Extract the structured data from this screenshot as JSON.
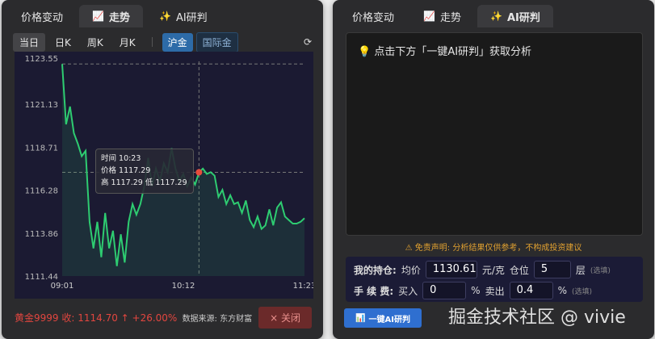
{
  "tabs": [
    "价格变动",
    "走势",
    "AI研判"
  ],
  "left": {
    "periods": [
      "当日",
      "日K",
      "周K",
      "月K"
    ],
    "markets": [
      "沪金",
      "国际金"
    ],
    "tooltip": {
      "time": "时间 10:23",
      "price": "价格 1117.29",
      "hl": "高 1117.29  低 1117.29"
    },
    "quote": "黄金9999  收: 1114.70 ↑ +26.00%",
    "source": "数据来源: 东方财富",
    "close": "× 关闭"
  },
  "chart_data": {
    "type": "line",
    "title": "",
    "yticks": [
      "1123.55",
      "1121.13",
      "1118.71",
      "1116.28",
      "1113.86",
      "1111.44"
    ],
    "ylim": [
      1111.44,
      1123.55
    ],
    "xticks": [
      "09:01",
      "10:12",
      "11:23"
    ],
    "series": [
      {
        "name": "黄金9999",
        "values": [
          1123.4,
          1120,
          1121,
          1119.5,
          1118.9,
          1118.2,
          1118.5,
          1114.5,
          1113,
          1114.5,
          1112.5,
          1115,
          1113,
          1114,
          1112,
          1113.8,
          1112.2,
          1114.5,
          1115.5,
          1114.9,
          1115.5,
          1116.5,
          1118.1,
          1116.5,
          1117.5,
          1116.8,
          1117.8,
          1117.3,
          1118.64,
          1117.5,
          1116.8,
          1117.2,
          1116.5,
          1117,
          1116.6,
          1117.29,
          1117.5,
          1117.2,
          1117.3,
          1117.1,
          1115.9,
          1116.3,
          1115.5,
          1116,
          1115.5,
          1115.6,
          1115,
          1115.7,
          1114.6,
          1114.2,
          1114.8,
          1114.1,
          1114.3,
          1115.2,
          1114.3,
          1115.3,
          1115.6,
          1114.8,
          1114.6,
          1114.4,
          1114.4,
          1114.5,
          1114.7
        ]
      }
    ],
    "crosshair": {
      "time": "10:23",
      "value": 1117.29
    },
    "line_color": "#2ecc71",
    "marker_color": "#e74c3c"
  },
  "right": {
    "prompt": "点击下方「一键AI研判」获取分析",
    "disclaimer": "⚠ 免责声明: 分析结果仅供参考，不构成投资建议",
    "hold_label": "我的持仓:",
    "avg_label": "均价",
    "avg": "1130.61",
    "unit": "元/克",
    "pos_label": "仓位",
    "pos": "5",
    "layer": "层",
    "optional": "(选填)",
    "fee_label": "手 续 费:",
    "buy_label": "买入",
    "buy": "0",
    "pct": "%",
    "sell_label": "卖出",
    "sell": "0.4",
    "ai_button": "一键AI研判"
  },
  "watermark": "掘金技术社区 @ vivie"
}
